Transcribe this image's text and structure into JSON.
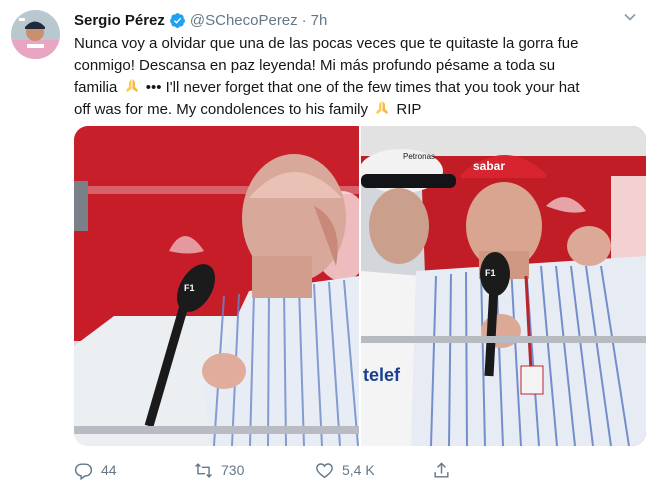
{
  "tweet": {
    "author_name": "Sergio Pérez",
    "handle": "@SChecoPerez",
    "separator": "·",
    "time": "7h",
    "text_lines": [
      "Nunca voy a olvidar que una de las pocas veces que te quitaste la gorra fue",
      "conmigo! Descansa en paz leyenda! Mi más profundo pésame a toda su",
      "familia",
      "••• I'll never forget that one of the few times that you took your hat",
      "off was for me. My condolences to his family",
      "RIP"
    ],
    "photo_texts": {
      "cap_logo": "sabar",
      "helmet_cap": "Petronas",
      "sponsor_overalls": "telef",
      "mic_logo": "F1"
    },
    "stats": {
      "replies": "44",
      "retweets": "730",
      "likes": "5,4 K"
    }
  },
  "icons": {
    "verified": "verified-badge-icon",
    "caret": "chevron-down-icon",
    "reply": "reply-icon",
    "retweet": "retweet-icon",
    "like": "heart-icon",
    "share": "share-icon",
    "emoji": "praying-hands-emoji"
  },
  "colors": {
    "verified_blue": "#1da1f2",
    "secondary_text": "#657786",
    "primary_text": "#14171a"
  }
}
